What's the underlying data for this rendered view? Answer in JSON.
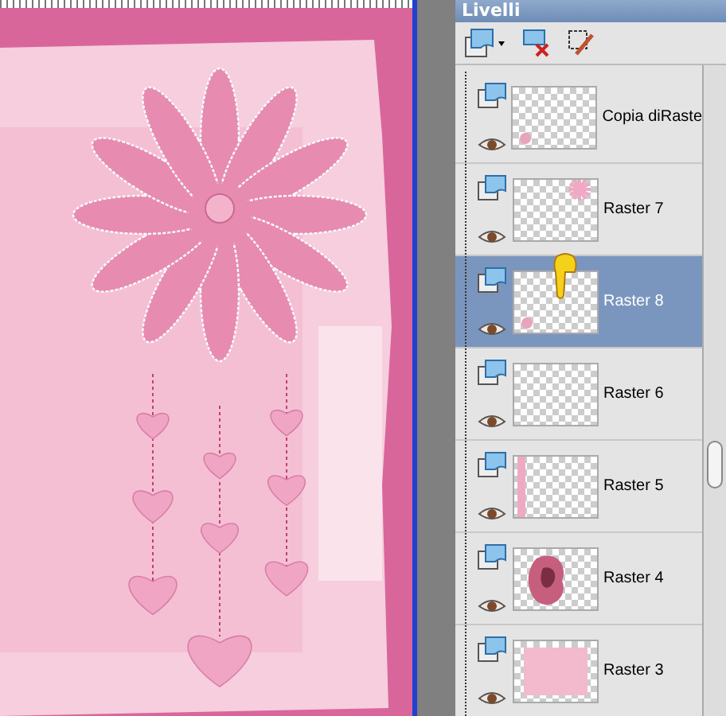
{
  "panel": {
    "title": "Livelli"
  },
  "layers": [
    {
      "name": "Copia diRaste",
      "selected": false,
      "visible": true,
      "kind": "dot"
    },
    {
      "name": "Raster 7",
      "selected": false,
      "visible": true,
      "kind": "flower"
    },
    {
      "name": "Raster 8",
      "selected": true,
      "visible": true,
      "kind": "dot"
    },
    {
      "name": "Raster 6",
      "selected": false,
      "visible": true,
      "kind": "blank"
    },
    {
      "name": "Raster 5",
      "selected": false,
      "visible": true,
      "kind": "strip"
    },
    {
      "name": "Raster 4",
      "selected": false,
      "visible": true,
      "kind": "photo"
    },
    {
      "name": "Raster 3",
      "selected": false,
      "visible": true,
      "kind": "paper"
    }
  ]
}
